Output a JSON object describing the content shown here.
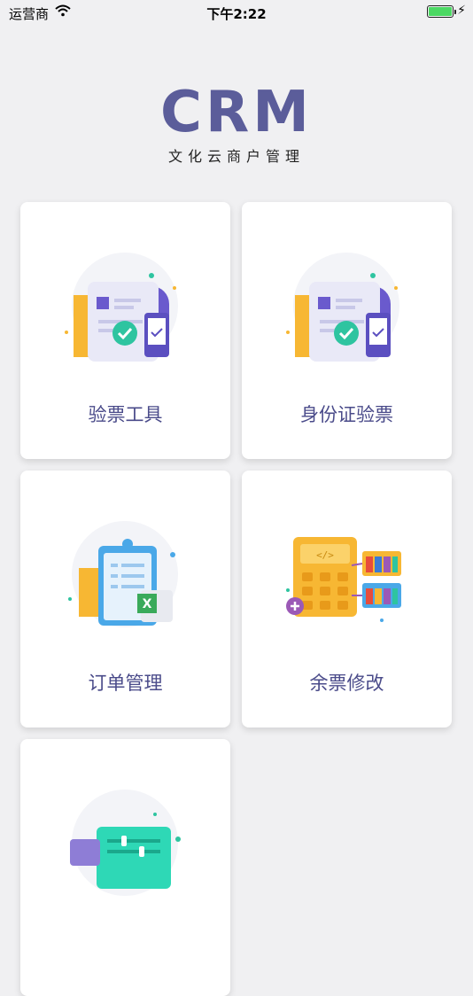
{
  "status_bar": {
    "carrier": "运营商",
    "time": "下午2:22"
  },
  "header": {
    "logo": "CRM",
    "subtitle": "文化云商户管理"
  },
  "menu": [
    {
      "label": "验票工具",
      "icon": "ticket-check-icon"
    },
    {
      "label": "身份证验票",
      "icon": "id-card-check-icon"
    },
    {
      "label": "订单管理",
      "icon": "order-clipboard-icon"
    },
    {
      "label": "余票修改",
      "icon": "remaining-tickets-icon"
    },
    {
      "label": "",
      "icon": "settings-panel-icon"
    }
  ],
  "colors": {
    "accent": "#5b5d9a",
    "label": "#4a4b8a",
    "background": "#f0f0f2"
  }
}
